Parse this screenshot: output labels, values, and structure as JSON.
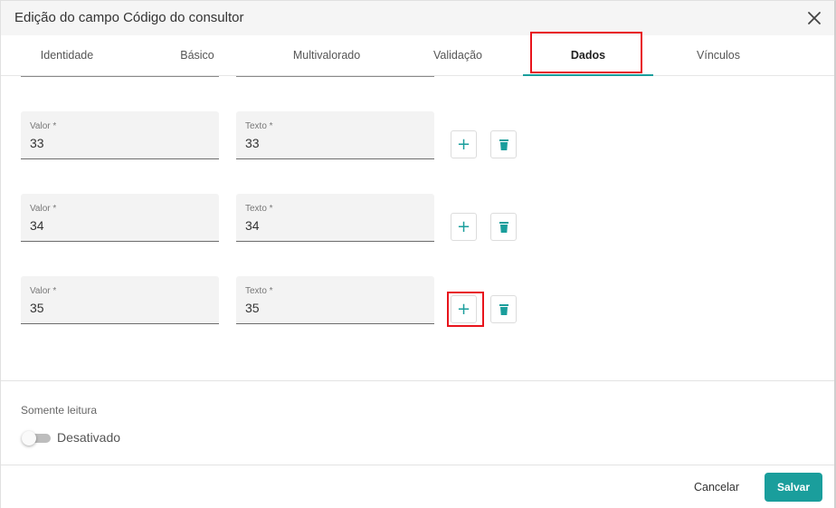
{
  "dialog": {
    "title": "Edição do campo Código do consultor"
  },
  "tabs": [
    {
      "label": "Identidade"
    },
    {
      "label": "Básico"
    },
    {
      "label": "Multivalorado"
    },
    {
      "label": "Validação"
    },
    {
      "label": "Dados"
    },
    {
      "label": "Vínculos"
    }
  ],
  "active_tab": "Dados",
  "rows": [
    {
      "valor_label": "Valor *",
      "valor": "33",
      "texto_label": "Texto *",
      "texto": "33"
    },
    {
      "valor_label": "Valor *",
      "valor": "34",
      "texto_label": "Texto *",
      "texto": "34"
    },
    {
      "valor_label": "Valor *",
      "valor": "35",
      "texto_label": "Texto *",
      "texto": "35"
    }
  ],
  "readonly": {
    "label": "Somente leitura",
    "state_text": "Desativado"
  },
  "footer": {
    "cancel_label": "Cancelar",
    "save_label": "Salvar"
  },
  "colors": {
    "accent": "#1a9e9c",
    "highlight": "#e8141c"
  }
}
